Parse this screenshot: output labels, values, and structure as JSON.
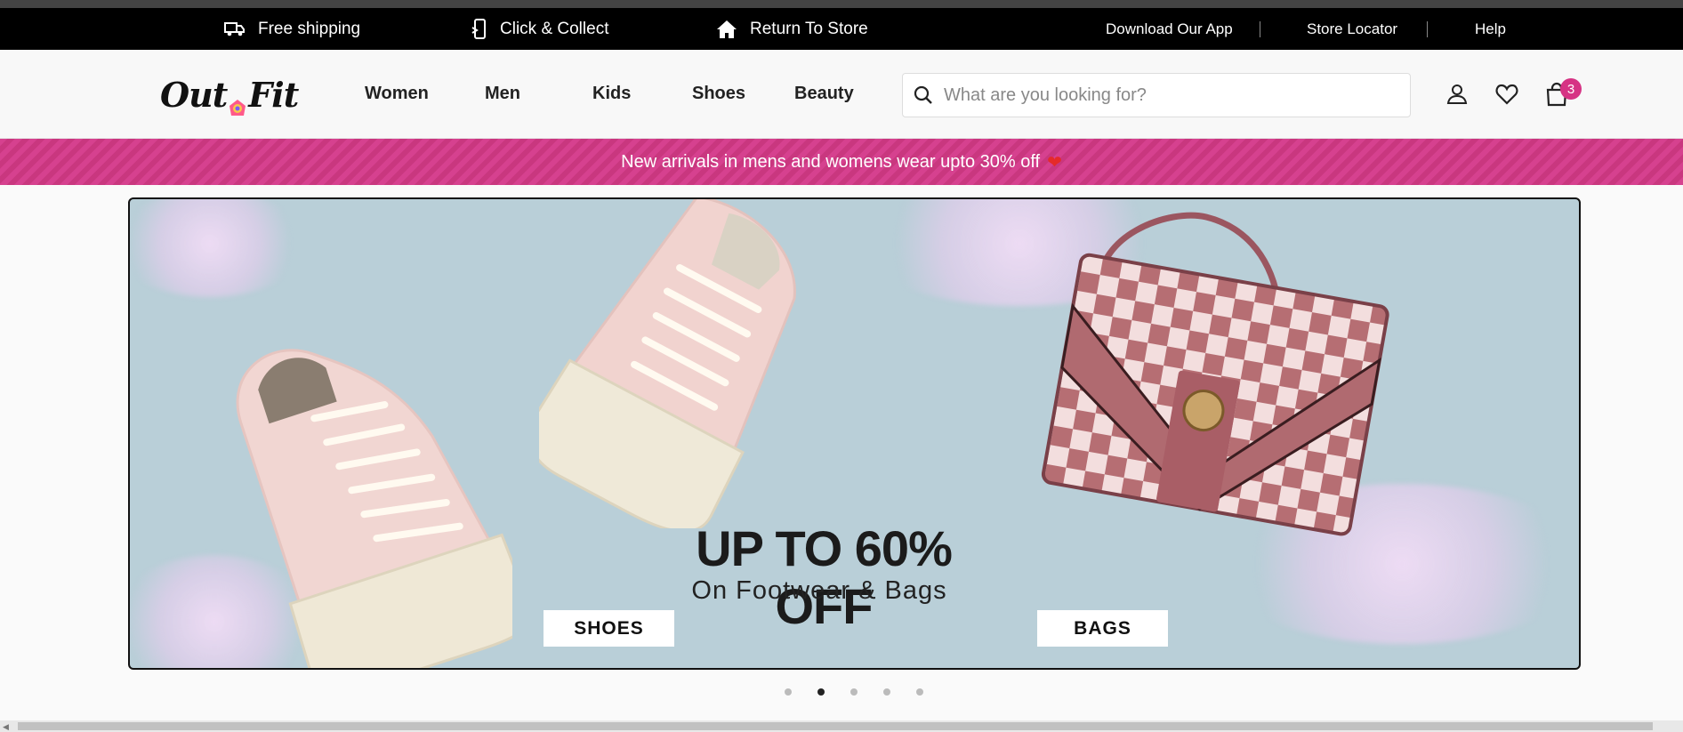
{
  "topbar": {
    "perks": [
      {
        "label": "Free shipping",
        "icon": "truck-icon"
      },
      {
        "label": "Click & Collect",
        "icon": "mobile-tap-icon"
      },
      {
        "label": "Return To Store",
        "icon": "home-icon"
      }
    ],
    "links": [
      "Download Our App",
      "Store Locator",
      "Help"
    ]
  },
  "header": {
    "logo_left": "Out",
    "logo_right": "Fit",
    "nav": [
      "Women",
      "Men",
      "Kids",
      "Shoes",
      "Beauty"
    ],
    "search_placeholder": "What are you looking for?",
    "cart_count": "3",
    "icons": [
      "user-icon",
      "heart-icon",
      "shopping-bag-icon"
    ]
  },
  "promo": {
    "text": "New arrivals in mens and womens wear upto 30% off",
    "emoji": "❤"
  },
  "hero": {
    "title": "UP TO 60% OFF",
    "subtitle": "On Footwear & Bags",
    "buttons": [
      "SHOES",
      "BAGS"
    ]
  },
  "carousel": {
    "total_slides": 5,
    "active_index": 1
  },
  "colors": {
    "accent": "#d6418f",
    "topbar_bg": "#000000",
    "hero_bg": "#b9cfd8"
  }
}
